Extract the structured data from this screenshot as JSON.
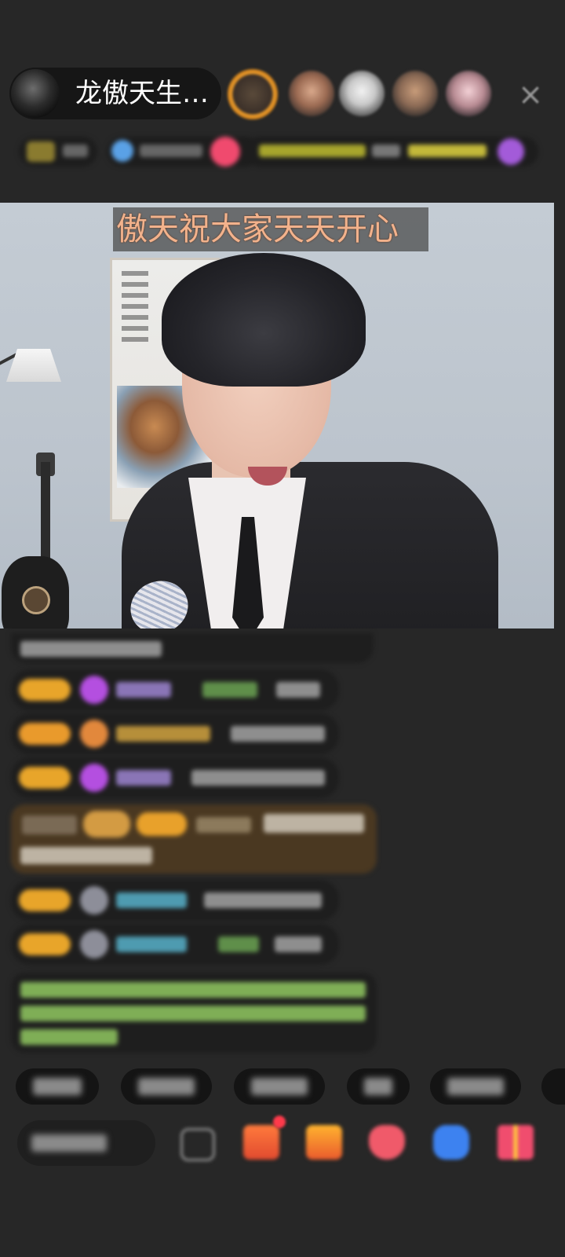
{
  "header": {
    "host_name": "龙傲天生…",
    "close_label": "×"
  },
  "video": {
    "banner_text": "傲天祝大家天天开心"
  },
  "colors": {
    "background": "#272727",
    "banner_text": "#f2b28c",
    "level_badge": "#e8a52a",
    "system_message": "#7fae56"
  },
  "icons": {
    "close": "close-icon",
    "emoji": "emoji-icon",
    "gift": "gift-icon",
    "heart": "heart-icon",
    "game": "game-icon",
    "more": "more-icon"
  }
}
